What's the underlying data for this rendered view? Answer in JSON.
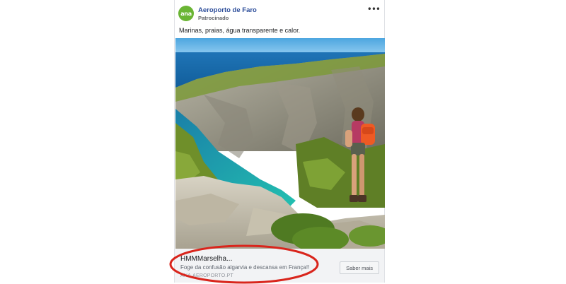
{
  "ad": {
    "page_name": "Aeroporto de Faro",
    "sponsored_label": "Patrocinado",
    "avatar_text": "ana",
    "post_text": "Marinas, praias, água transparente e calor.",
    "link": {
      "title": "HMMMarselha...",
      "description": "Foge da confusão algarvia e descansa em França!!",
      "domain": "ANA.AEROPORTO.PT",
      "cta_label": "Saber mais"
    },
    "more_icon": "more-options-icon",
    "image_icon": "photo-calanques-hiker"
  },
  "colors": {
    "avatar": "#6ab534",
    "page_name": "#2c4d9a",
    "highlight_oval": "#d9251c"
  }
}
